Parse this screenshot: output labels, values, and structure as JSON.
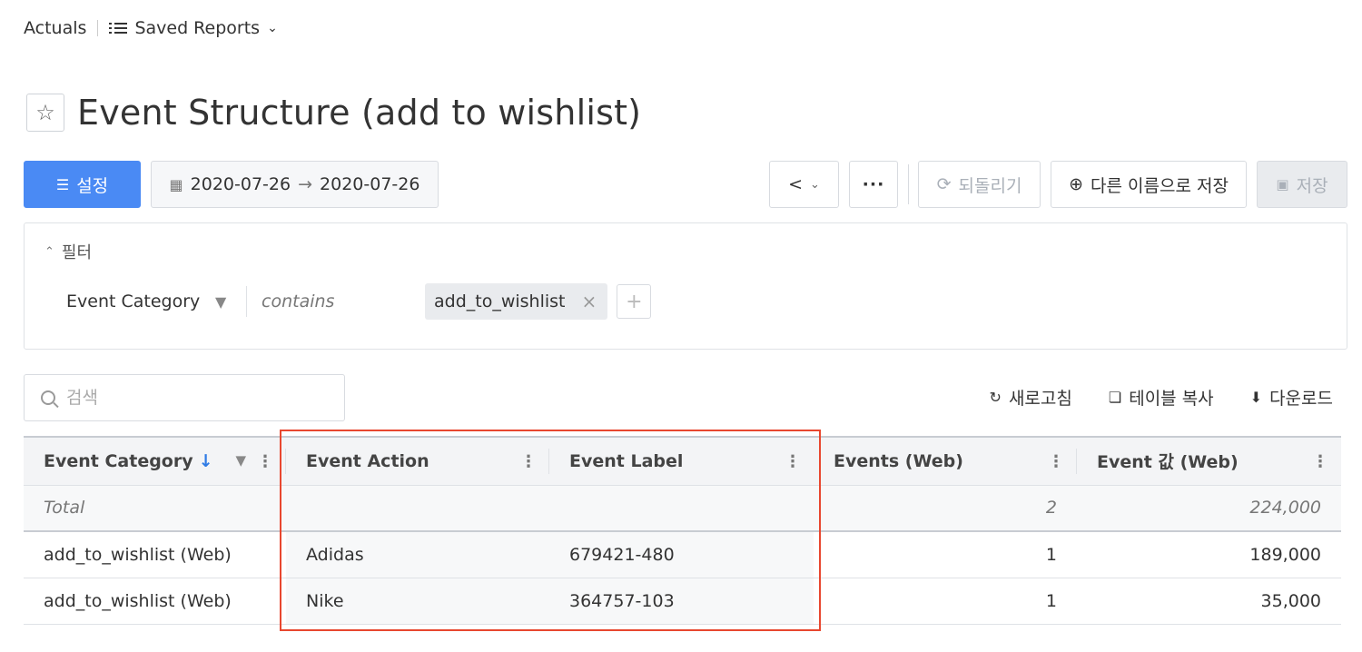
{
  "breadcrumb": {
    "actuals": "Actuals",
    "saved_reports": "Saved Reports"
  },
  "page_title": "Event Structure (add to wishlist)",
  "toolbar": {
    "settings_label": "설정",
    "date_start": "2020-07-26",
    "date_end": "2020-07-26",
    "revert_label": "되돌리기",
    "save_as_label": "다른 이름으로 저장",
    "save_label": "저장"
  },
  "filter": {
    "header": "필터",
    "dimension": "Event Category",
    "operator": "contains",
    "value": "add_to_wishlist"
  },
  "search": {
    "placeholder": "검색"
  },
  "actions": {
    "refresh": "새로고침",
    "copy_table": "테이블 복사",
    "download": "다운로드"
  },
  "table": {
    "columns": [
      "Event Category",
      "Event Action",
      "Event Label",
      "Events (Web)",
      "Event 값 (Web)"
    ],
    "total": {
      "label": "Total",
      "events": "2",
      "value": "224,000"
    },
    "rows": [
      {
        "category": "add_to_wishlist (Web)",
        "action": "Adidas",
        "label": "679421-480",
        "events": "1",
        "value": "189,000"
      },
      {
        "category": "add_to_wishlist (Web)",
        "action": "Nike",
        "label": "364757-103",
        "events": "1",
        "value": "35,000"
      }
    ]
  },
  "colors": {
    "primary": "#4a8af4",
    "highlight": "#e8472f",
    "sort_arrow": "#2f7be5"
  }
}
